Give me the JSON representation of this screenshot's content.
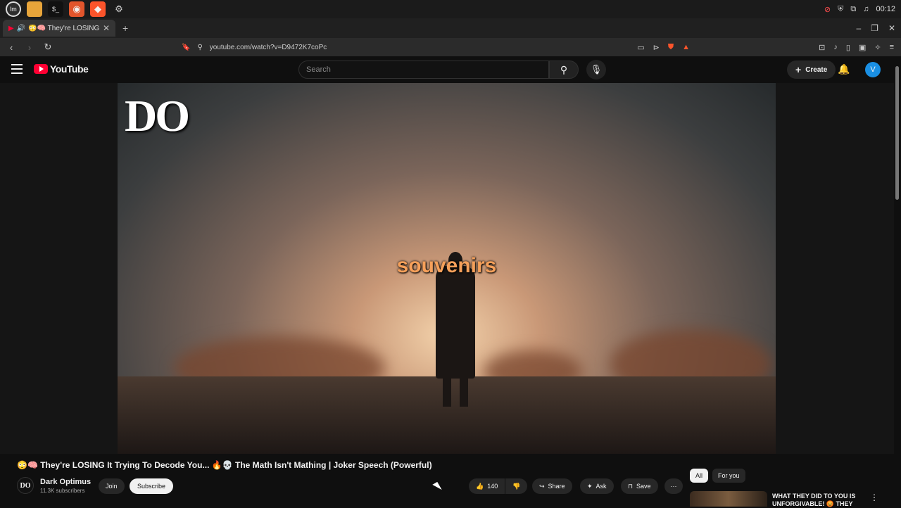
{
  "os": {
    "clock": "00:12",
    "launcher_icons": [
      "mint-menu-icon",
      "files-icon",
      "terminal-icon",
      "app-icon",
      "brave-icon",
      "settings-icon"
    ]
  },
  "browser": {
    "tab_title": "😳🧠 They're LOSING It Try",
    "new_tab": "+",
    "url": "youtube.com/watch?v=D9472K7coPc"
  },
  "youtube": {
    "logo_text": "YouTube",
    "search_placeholder": "Search",
    "create_label": "Create",
    "avatar_letter": "V"
  },
  "player": {
    "watermark": "DO",
    "caption": "souvenirs"
  },
  "video": {
    "title": "😳🧠 They're LOSING It Trying To Decode You... 🔥💀 The Math Isn't Mathing | Joker Speech (Powerful)",
    "channel_name": "Dark Optimus",
    "channel_avatar": "DO",
    "subscribers": "11.3K subscribers",
    "join_label": "Join",
    "subscribe_label": "Subscribe",
    "likes": "140",
    "share_label": "Share",
    "ask_label": "Ask",
    "save_label": "Save"
  },
  "recommendations": {
    "chips": [
      "All",
      "For you"
    ],
    "first_title": "WHAT THEY DID TO YOU IS UNFORGIVABLE! 😡 THEY"
  },
  "colors": {
    "yt_red": "#ff0033",
    "caption_orange": "#f6a05a",
    "avatar_blue": "#1a8fe3"
  }
}
